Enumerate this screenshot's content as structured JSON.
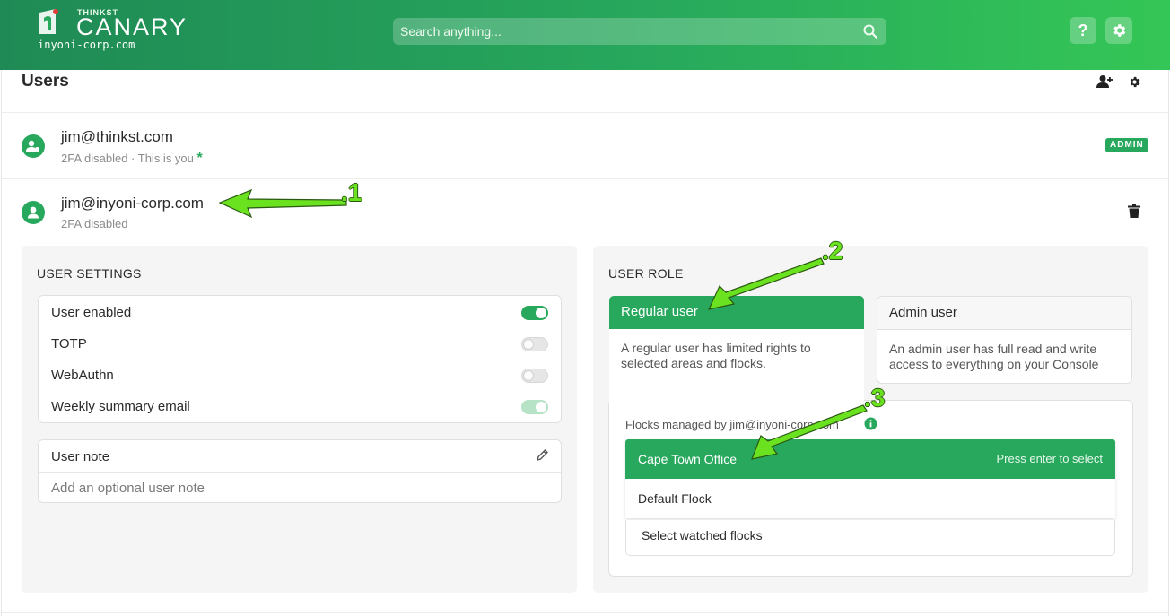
{
  "header": {
    "brand_small": "THINKST",
    "brand": "CANARY",
    "domain": "inyoni-corp.com",
    "search_placeholder": "Search anything...",
    "help_label": "?",
    "colors": {
      "primary": "#27a85c",
      "gradient_start": "#1f8a55",
      "gradient_end": "#34c656"
    }
  },
  "page": {
    "title": "Users"
  },
  "users": [
    {
      "email": "jim@thinkst.com",
      "status": "2FA disabled · This is you",
      "status_mark": "*",
      "badge": "ADMIN"
    },
    {
      "email": "jim@inyoni-corp.com",
      "status": "2FA disabled"
    }
  ],
  "user_settings": {
    "title": "USER SETTINGS",
    "toggles": [
      {
        "label": "User enabled",
        "state": "on"
      },
      {
        "label": "TOTP",
        "state": "off"
      },
      {
        "label": "WebAuthn",
        "state": "off"
      },
      {
        "label": "Weekly summary email",
        "state": "on-disabled"
      }
    ],
    "note_label": "User note",
    "note_placeholder": "Add an optional user note"
  },
  "user_role": {
    "title": "USER ROLE",
    "regular": {
      "label": "Regular user",
      "description": "A regular user has limited rights to selected areas and flocks.",
      "selected": true
    },
    "admin": {
      "label": "Admin user",
      "description": "An admin user has full read and write access to everything on your Console",
      "selected": false
    },
    "flocks_label": "Flocks managed by jim@inyoni-corp.com",
    "dropdown": [
      {
        "label": "Cape Town Office",
        "hint": "Press enter to select",
        "highlighted": true
      },
      {
        "label": "Default Flock",
        "hint": "",
        "highlighted": false
      }
    ],
    "watched_placeholder": "Select watched flocks"
  },
  "annotations": [
    ".1",
    ".2",
    ".3"
  ]
}
